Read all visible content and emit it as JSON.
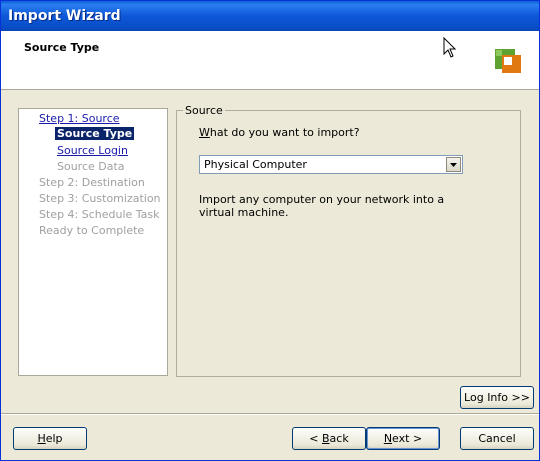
{
  "window": {
    "title": "Import Wizard"
  },
  "header": {
    "title": "Source Type"
  },
  "nav": {
    "step1": "Step 1: Source",
    "source_type": "Source Type",
    "source_login": "Source Login",
    "source_data": "Source Data",
    "step2": "Step 2: Destination",
    "step3": "Step 3: Customization",
    "step4": "Step 4: Schedule Task",
    "ready": "Ready to Complete"
  },
  "content": {
    "group_label": "Source",
    "question_accel": "W",
    "question_rest": "hat do you want to import?",
    "select_value": "Physical Computer",
    "description": "Import any computer on your network into a virtual machine."
  },
  "buttons": {
    "log_info": "Log Info >>",
    "help_accel": "H",
    "help_rest": "elp",
    "back_pre": "< ",
    "back_accel": "B",
    "back_rest": "ack",
    "next_accel": "N",
    "next_rest": "ext >",
    "cancel": "Cancel"
  },
  "colors": {
    "title_bar": "#0a4fc9",
    "selection": "#0a246a",
    "link": "#1a1aaa",
    "disabled": "#a0a0a0"
  }
}
